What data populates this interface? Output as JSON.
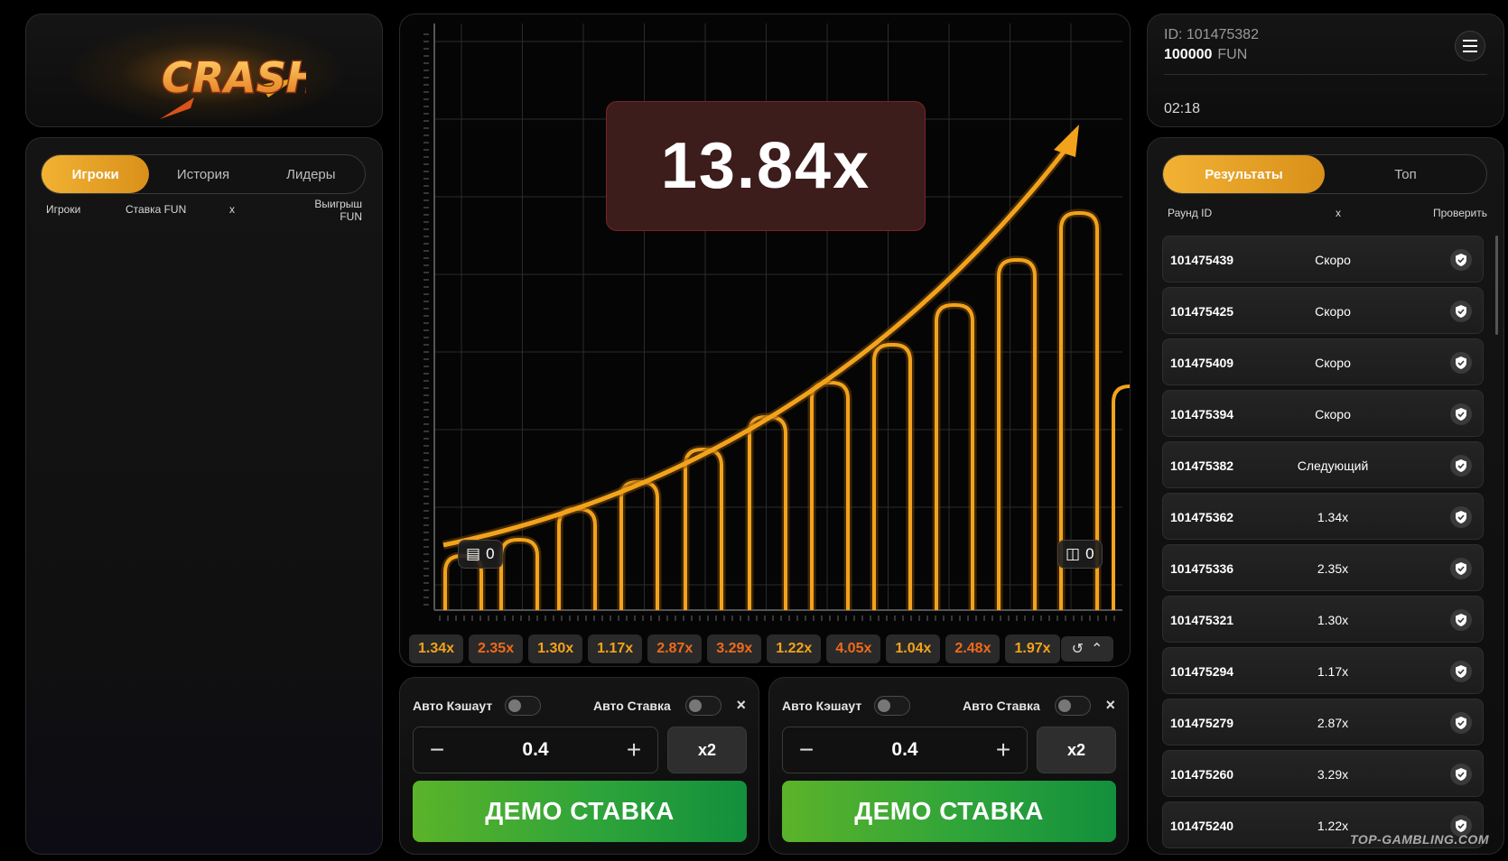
{
  "left": {
    "tabs": [
      {
        "label": "Игроки",
        "active": true
      },
      {
        "label": "История",
        "active": false
      },
      {
        "label": "Лидеры",
        "active": false
      }
    ],
    "columns": {
      "players": "Игроки",
      "bet": "Ставка  FUN",
      "x": "x",
      "win_line1": "Выигрыш",
      "win_line2": "FUN"
    },
    "logo_icon": "crash-logo"
  },
  "game": {
    "multiplier": "13.84x",
    "counter_left": "0",
    "counter_right": "0",
    "history": [
      {
        "v": "1.34x",
        "color": "#f2a31b"
      },
      {
        "v": "2.35x",
        "color": "#ef6a1a"
      },
      {
        "v": "1.30x",
        "color": "#f2a31b"
      },
      {
        "v": "1.17x",
        "color": "#f2a31b"
      },
      {
        "v": "2.87x",
        "color": "#ef6a1a"
      },
      {
        "v": "3.29x",
        "color": "#ef6a1a"
      },
      {
        "v": "1.22x",
        "color": "#f2a31b"
      },
      {
        "v": "4.05x",
        "color": "#ef6a1a"
      },
      {
        "v": "1.04x",
        "color": "#f2a31b"
      },
      {
        "v": "2.48x",
        "color": "#ef6a1a"
      },
      {
        "v": "1.97x",
        "color": "#f2a31b"
      }
    ],
    "accent": "#f2a31b"
  },
  "bet1": {
    "auto_cashout": "Авто Кэшаут",
    "auto_bet": "Авто Ставка",
    "amount": "0.4",
    "minus": "−",
    "plus": "+",
    "x2": "x2",
    "button": "ДЕМО СТАВКА",
    "close": "×"
  },
  "bet2": {
    "auto_cashout": "Авто Кэшаут",
    "auto_bet": "Авто Ставка",
    "amount": "0.4",
    "minus": "−",
    "plus": "+",
    "x2": "x2",
    "button": "ДЕМО СТАВКА",
    "close": "×"
  },
  "user": {
    "id": "ID: 101475382",
    "balance": "100000",
    "currency": "FUN",
    "timer": "02:18"
  },
  "results": {
    "tabs": [
      {
        "label": "Результаты",
        "active": true
      },
      {
        "label": "Топ",
        "active": false
      }
    ],
    "columns": {
      "round": "Раунд ID",
      "x": "x",
      "check": "Проверить"
    },
    "rows": [
      {
        "id": "101475439",
        "x": "Скоро"
      },
      {
        "id": "101475425",
        "x": "Скоро"
      },
      {
        "id": "101475409",
        "x": "Скоро"
      },
      {
        "id": "101475394",
        "x": "Скоро"
      },
      {
        "id": "101475382",
        "x": "Следующий"
      },
      {
        "id": "101475362",
        "x": "1.34x"
      },
      {
        "id": "101475336",
        "x": "2.35x"
      },
      {
        "id": "101475321",
        "x": "1.30x"
      },
      {
        "id": "101475294",
        "x": "1.17x"
      },
      {
        "id": "101475279",
        "x": "2.87x"
      },
      {
        "id": "101475260",
        "x": "3.29x"
      },
      {
        "id": "101475240",
        "x": "1.22x"
      }
    ],
    "watermark": "TOP-GAMBLING.COM"
  }
}
